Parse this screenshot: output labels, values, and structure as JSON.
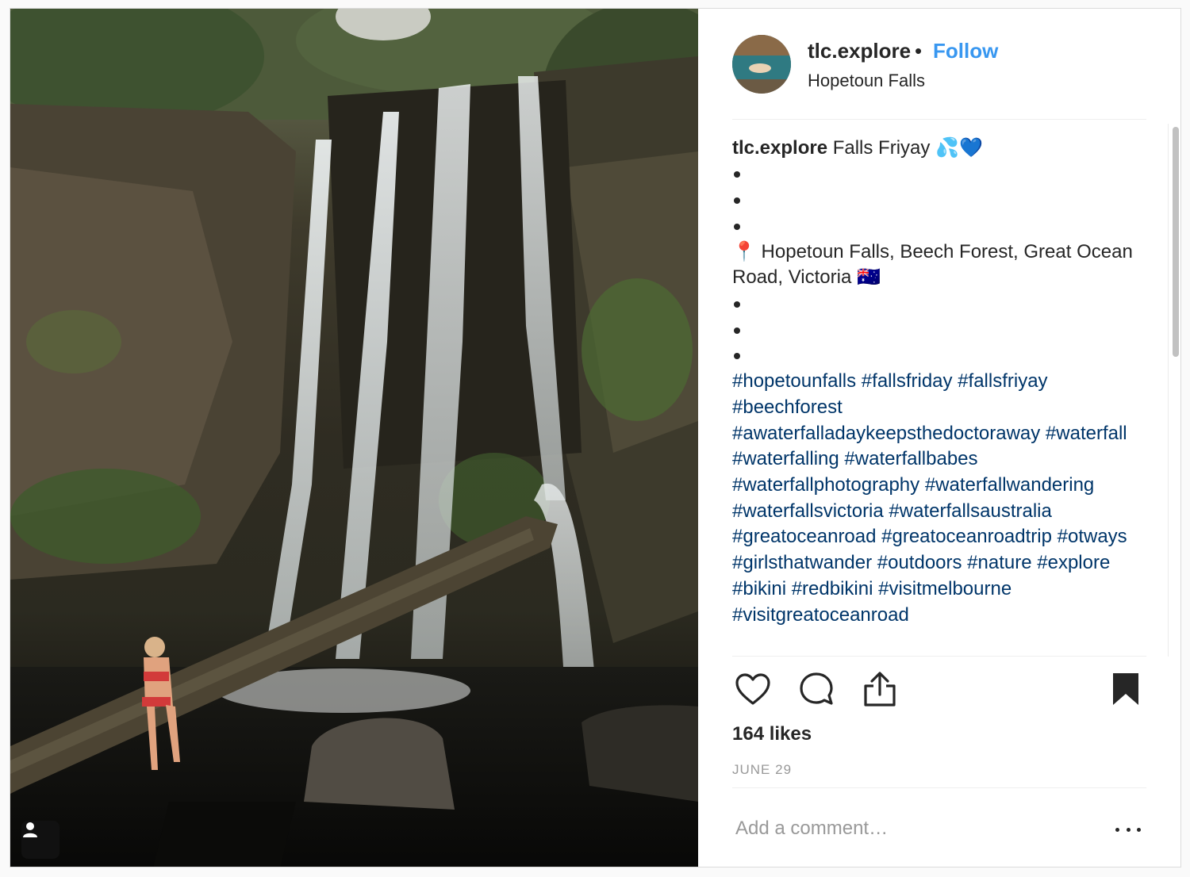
{
  "post": {
    "username": "tlc.explore",
    "separator": "•",
    "follow_label": "Follow",
    "location": "Hopetoun Falls"
  },
  "caption": {
    "username": "tlc.explore",
    "text": "Falls Friyay 💦💙",
    "location_line": "📍 Hopetoun Falls, Beech Forest, Great Ocean Road, Victoria 🇦🇺",
    "hashtags": "#hopetounfalls #fallsfriday #fallsfriyay #beechforest #awaterfalladaykeepsthedoctoraway #waterfall #waterfalling #waterfallbabes #waterfallphotography #waterfallwandering #waterfallsvictoria #waterfallsaustralia #greatoceanroad #greatoceanroadtrip #otways #girlsthatwander #outdoors #nature #explore #bikini #redbikini #visitmelbourne #visitgreatoceanroad"
  },
  "likes": "164 likes",
  "date": "JUNE 29",
  "comment": {
    "placeholder": "Add a comment…"
  },
  "icons": {
    "like": "heart-icon",
    "comment": "comment-icon",
    "share": "share-icon",
    "save": "bookmark-icon",
    "more": "more-icon",
    "tagged": "user-tag-icon"
  }
}
